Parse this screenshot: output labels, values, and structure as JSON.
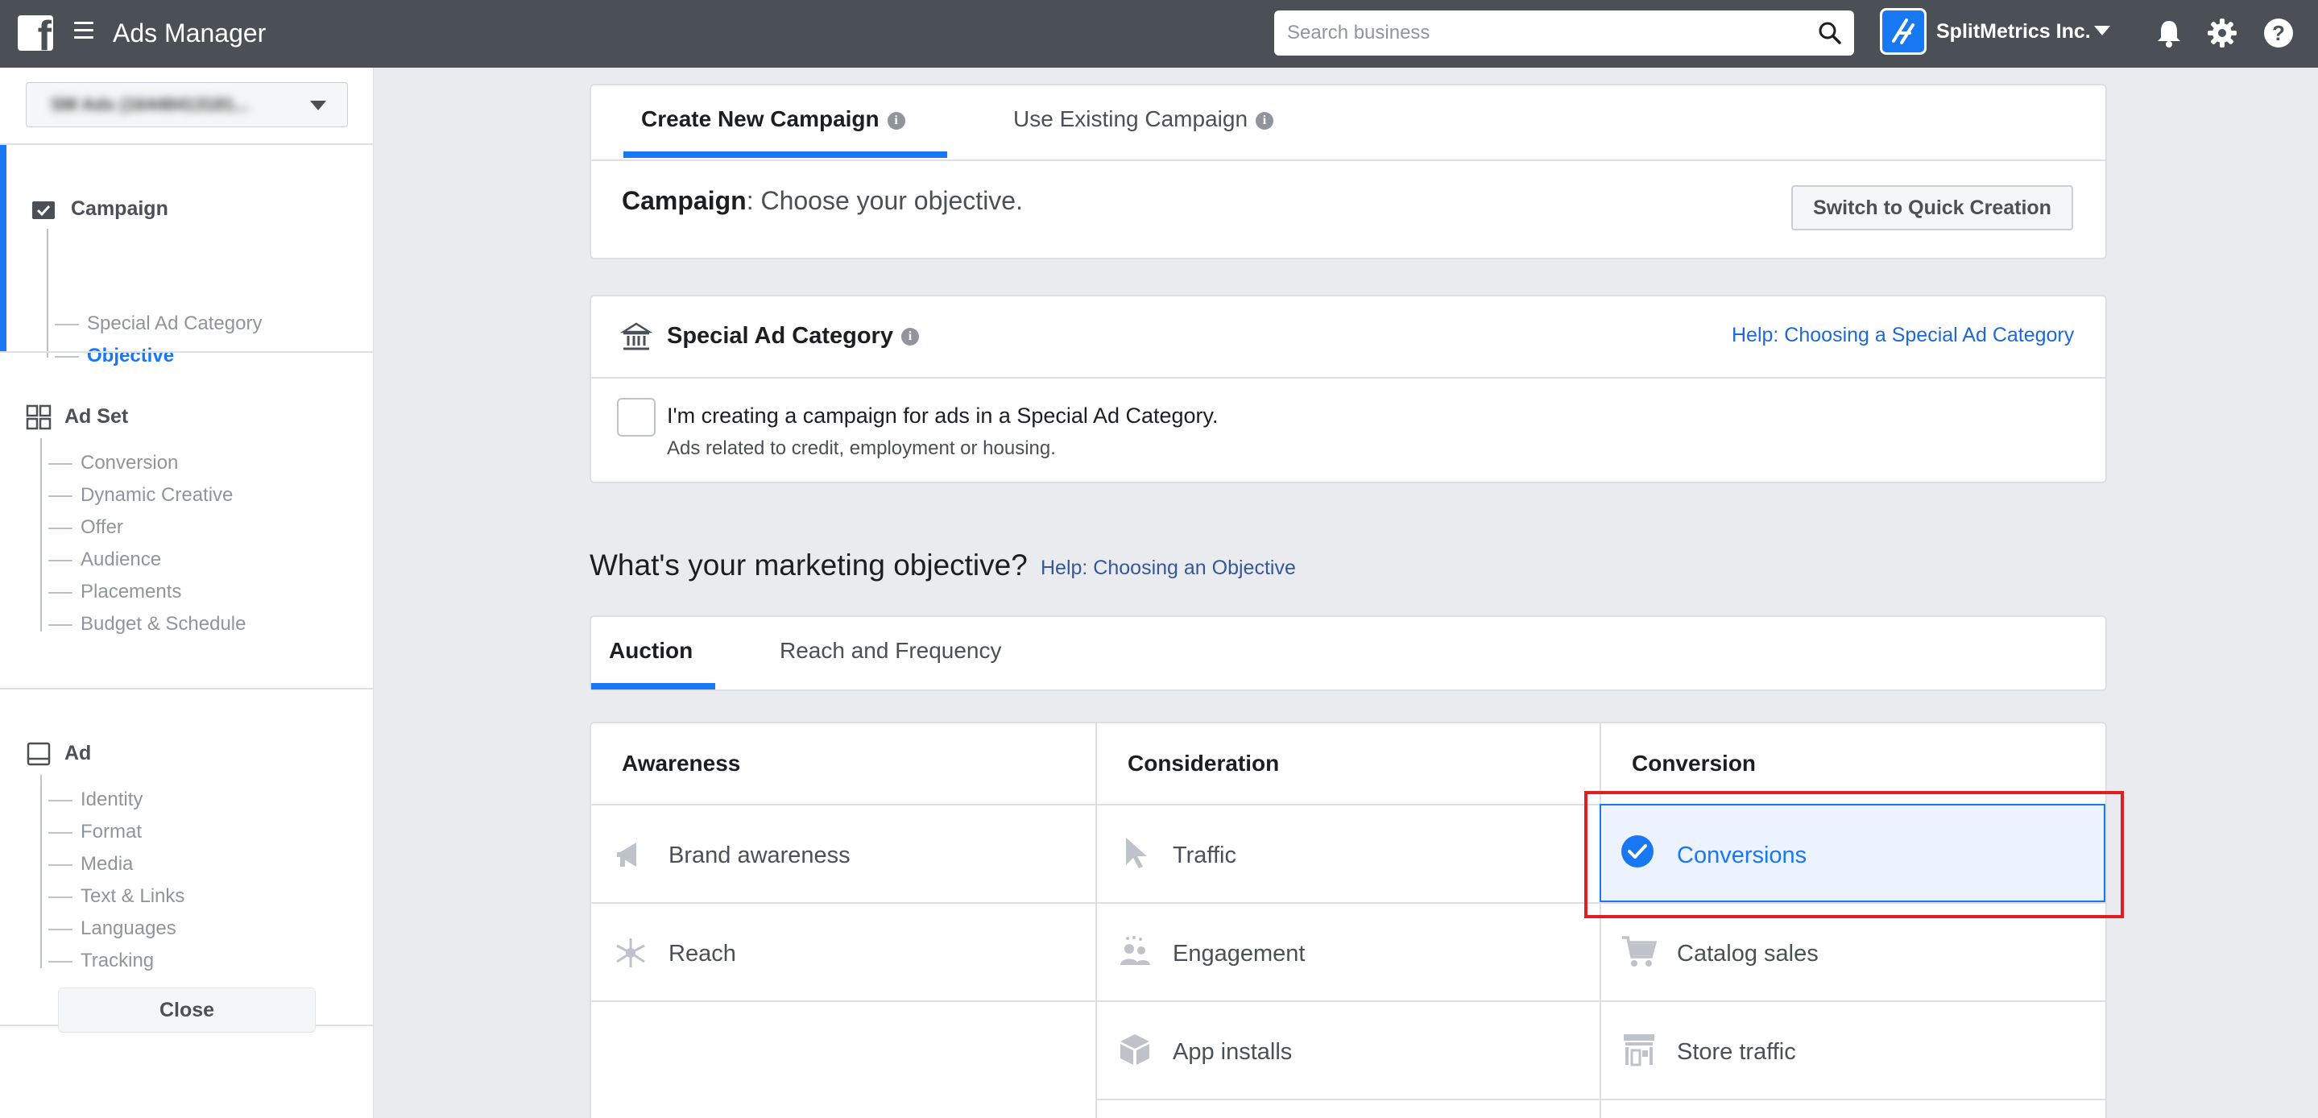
{
  "topbar": {
    "app_title": "Ads Manager",
    "search_placeholder": "Search business",
    "business_name": "SplitMetrics Inc."
  },
  "sidebar": {
    "account_name": "SM Ads (16448413181...",
    "campaign": {
      "title": "Campaign",
      "items": [
        "Special Ad Category",
        "Objective"
      ]
    },
    "ad_set": {
      "title": "Ad Set",
      "items": [
        "Conversion",
        "Dynamic Creative",
        "Offer",
        "Audience",
        "Placements",
        "Budget & Schedule"
      ]
    },
    "ad": {
      "title": "Ad",
      "items": [
        "Identity",
        "Format",
        "Media",
        "Text & Links",
        "Languages",
        "Tracking"
      ]
    },
    "close_label": "Close"
  },
  "campaign_card": {
    "tab_create": "Create New Campaign",
    "tab_existing": "Use Existing Campaign",
    "heading_bold": "Campaign",
    "heading_rest": ": Choose your objective.",
    "quick_creation_label": "Switch to Quick Creation"
  },
  "special_ad": {
    "title": "Special Ad Category",
    "help_link": "Help: Choosing a Special Ad Category",
    "checkbox_label": "I'm creating a campaign for ads in a Special Ad Category.",
    "checkbox_sub": "Ads related to credit, employment or housing."
  },
  "objective": {
    "question": "What's your marketing objective?",
    "help_link": "Help: Choosing an Objective",
    "tab_auction": "Auction",
    "tab_reach_frequency": "Reach and Frequency",
    "columns": {
      "awareness": {
        "title": "Awareness",
        "items": [
          "Brand awareness",
          "Reach"
        ]
      },
      "consideration": {
        "title": "Consideration",
        "items": [
          "Traffic",
          "Engagement",
          "App installs"
        ]
      },
      "conversion": {
        "title": "Conversion",
        "items": [
          "Conversions",
          "Catalog sales",
          "Store traffic"
        ]
      }
    },
    "selected": "Conversions"
  },
  "colors": {
    "accent": "#1877f2",
    "topbar": "#4b4f56",
    "highlight": "#e02020"
  }
}
